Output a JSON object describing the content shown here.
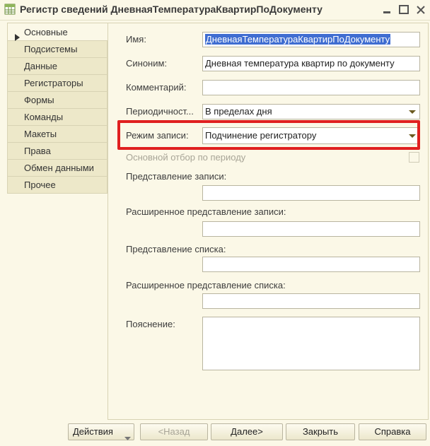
{
  "window": {
    "title": "Регистр сведений ДневнаяТемператураКвартирПоДокументу"
  },
  "tabs": [
    {
      "label": "Основные",
      "active": true
    },
    {
      "label": "Подсистемы",
      "active": false
    },
    {
      "label": "Данные",
      "active": false
    },
    {
      "label": "Регистраторы",
      "active": false
    },
    {
      "label": "Формы",
      "active": false
    },
    {
      "label": "Команды",
      "active": false
    },
    {
      "label": "Макеты",
      "active": false
    },
    {
      "label": "Права",
      "active": false
    },
    {
      "label": "Обмен данными",
      "active": false
    },
    {
      "label": "Прочее",
      "active": false
    }
  ],
  "form": {
    "name_label": "Имя:",
    "name_value": "ДневнаяТемператураКвартирПоДокументу",
    "synonym_label": "Синоним:",
    "synonym_value": "Дневная температура квартир по документу",
    "comment_label": "Комментарий:",
    "comment_value": "",
    "periodicity_label": "Периодичност...",
    "periodicity_value": "В пределах дня",
    "write_mode_label": "Режим записи:",
    "write_mode_value": "Подчинение регистратору",
    "main_filter_label": "Основной отбор по периоду",
    "main_filter_checked": false,
    "record_presentation_label": "Представление записи:",
    "record_presentation_value": "",
    "ext_record_presentation_label": "Расширенное представление записи:",
    "ext_record_presentation_value": "",
    "list_presentation_label": "Представление списка:",
    "list_presentation_value": "",
    "ext_list_presentation_label": "Расширенное представление списка:",
    "ext_list_presentation_value": "",
    "explanation_label": "Пояснение:",
    "explanation_value": ""
  },
  "buttons": {
    "actions": "Действия",
    "back": "<Назад",
    "next": "Далее>",
    "close": "Закрыть",
    "help": "Справка"
  },
  "colors": {
    "background": "#fbf8e7",
    "highlight": "#e02020",
    "selection": "#3f6dd1"
  }
}
